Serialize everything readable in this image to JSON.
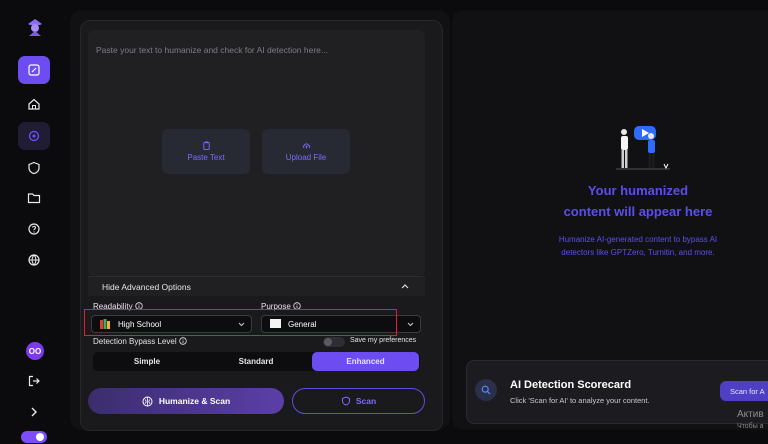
{
  "sidebar": {
    "items": [
      {
        "name": "edit"
      },
      {
        "name": "home"
      },
      {
        "name": "ai-detector"
      },
      {
        "name": "shield"
      },
      {
        "name": "folder"
      },
      {
        "name": "help"
      },
      {
        "name": "globe"
      }
    ],
    "avatar_initials": "OO"
  },
  "editor": {
    "placeholder": "Paste your text to humanize and check for AI detection here...",
    "paste_label": "Paste Text",
    "upload_label": "Upload File"
  },
  "advanced": {
    "toggle_label": "Hide Advanced Options",
    "readability_label": "Readability",
    "readability_value": "High School",
    "purpose_label": "Purpose",
    "purpose_value": "General",
    "bypass_label": "Detection Bypass Level",
    "save_prefs_label": "Save my preferences",
    "levels": [
      "Simple",
      "Standard",
      "Enhanced"
    ],
    "active_level": "Enhanced"
  },
  "actions": {
    "humanize_label": "Humanize & Scan",
    "scan_label": "Scan"
  },
  "result": {
    "title_line1": "Your humanized",
    "title_line2": "content will appear here",
    "desc_line1": "Humanize AI-generated content to bypass AI",
    "desc_line2": "detectors like GPTZero, Turnitin, and more."
  },
  "scorecard": {
    "title": "AI Detection Scorecard",
    "subtitle": "Click 'Scan for AI' to analyze your content.",
    "button_label": "Scan for A"
  },
  "watermark": {
    "line1": "Актив",
    "line2": "Чтобы а"
  },
  "colors": {
    "accent": "#6d4df2",
    "accent_text": "#5b4ef0",
    "highlight_box": "#e0202a"
  }
}
